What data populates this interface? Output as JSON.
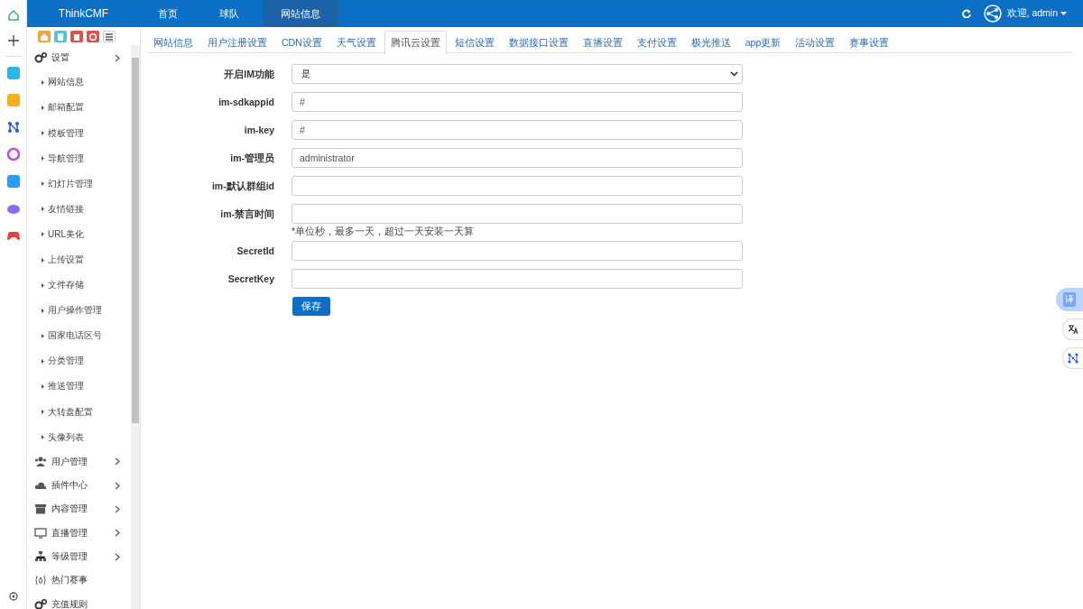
{
  "topbar": {
    "brand": "ThinkCMF",
    "nav": [
      {
        "label": "首页",
        "selected": false
      },
      {
        "label": "球队",
        "selected": false
      },
      {
        "label": "网站信息",
        "selected": true
      }
    ],
    "user": "欢迎, admin"
  },
  "sidebar": {
    "items": [
      {
        "label": "设置",
        "kind": "group",
        "children": [
          {
            "label": "网站信息"
          },
          {
            "label": "邮箱配置"
          },
          {
            "label": "模板管理"
          },
          {
            "label": "导航管理"
          },
          {
            "label": "幻灯片管理"
          },
          {
            "label": "友情链接"
          },
          {
            "label": "URL美化"
          },
          {
            "label": "上传设置"
          },
          {
            "label": "文件存储"
          },
          {
            "label": "用户操作管理"
          },
          {
            "label": "国家电话区号"
          },
          {
            "label": "分类管理"
          },
          {
            "label": "推送管理"
          },
          {
            "label": "大转盘配置"
          },
          {
            "label": "头像列表"
          }
        ]
      },
      {
        "label": "用户管理",
        "kind": "group"
      },
      {
        "label": "插件中心",
        "kind": "group"
      },
      {
        "label": "内容管理",
        "kind": "group"
      },
      {
        "label": "直播管理",
        "kind": "group"
      },
      {
        "label": "等级管理",
        "kind": "group"
      },
      {
        "label": "热门赛事",
        "kind": "link"
      },
      {
        "label": "充值规则",
        "kind": "link"
      }
    ]
  },
  "tabs": [
    {
      "label": "网站信息",
      "selected": false
    },
    {
      "label": "用户注册设置",
      "selected": false
    },
    {
      "label": "CDN设置",
      "selected": false
    },
    {
      "label": "天气设置",
      "selected": false
    },
    {
      "label": "腾讯云设置",
      "selected": true
    },
    {
      "label": "短信设置",
      "selected": false
    },
    {
      "label": "数据接口设置",
      "selected": false
    },
    {
      "label": "直播设置",
      "selected": false
    },
    {
      "label": "支付设置",
      "selected": false
    },
    {
      "label": "极光推送",
      "selected": false
    },
    {
      "label": "app更新",
      "selected": false
    },
    {
      "label": "活动设置",
      "selected": false
    },
    {
      "label": "赛事设置",
      "selected": false
    }
  ],
  "form": {
    "fields": [
      {
        "label": "开启IM功能",
        "kind": "select",
        "value": "是"
      },
      {
        "label": "im-sdkappid",
        "kind": "input",
        "value": "#"
      },
      {
        "label": "im-key",
        "kind": "input",
        "value": "#"
      },
      {
        "label": "im-管理员",
        "kind": "input",
        "value": "administrator"
      },
      {
        "label": "im-默认群组id",
        "kind": "input"
      },
      {
        "label": "im-禁言时间",
        "kind": "input",
        "hint": "*单位秒，最多一天，超过一天安装一天算"
      },
      {
        "label": "SecretId",
        "kind": "input"
      },
      {
        "label": "SecretKey",
        "kind": "input"
      }
    ],
    "submit": "保存"
  },
  "floating": {
    "translate": "译"
  }
}
